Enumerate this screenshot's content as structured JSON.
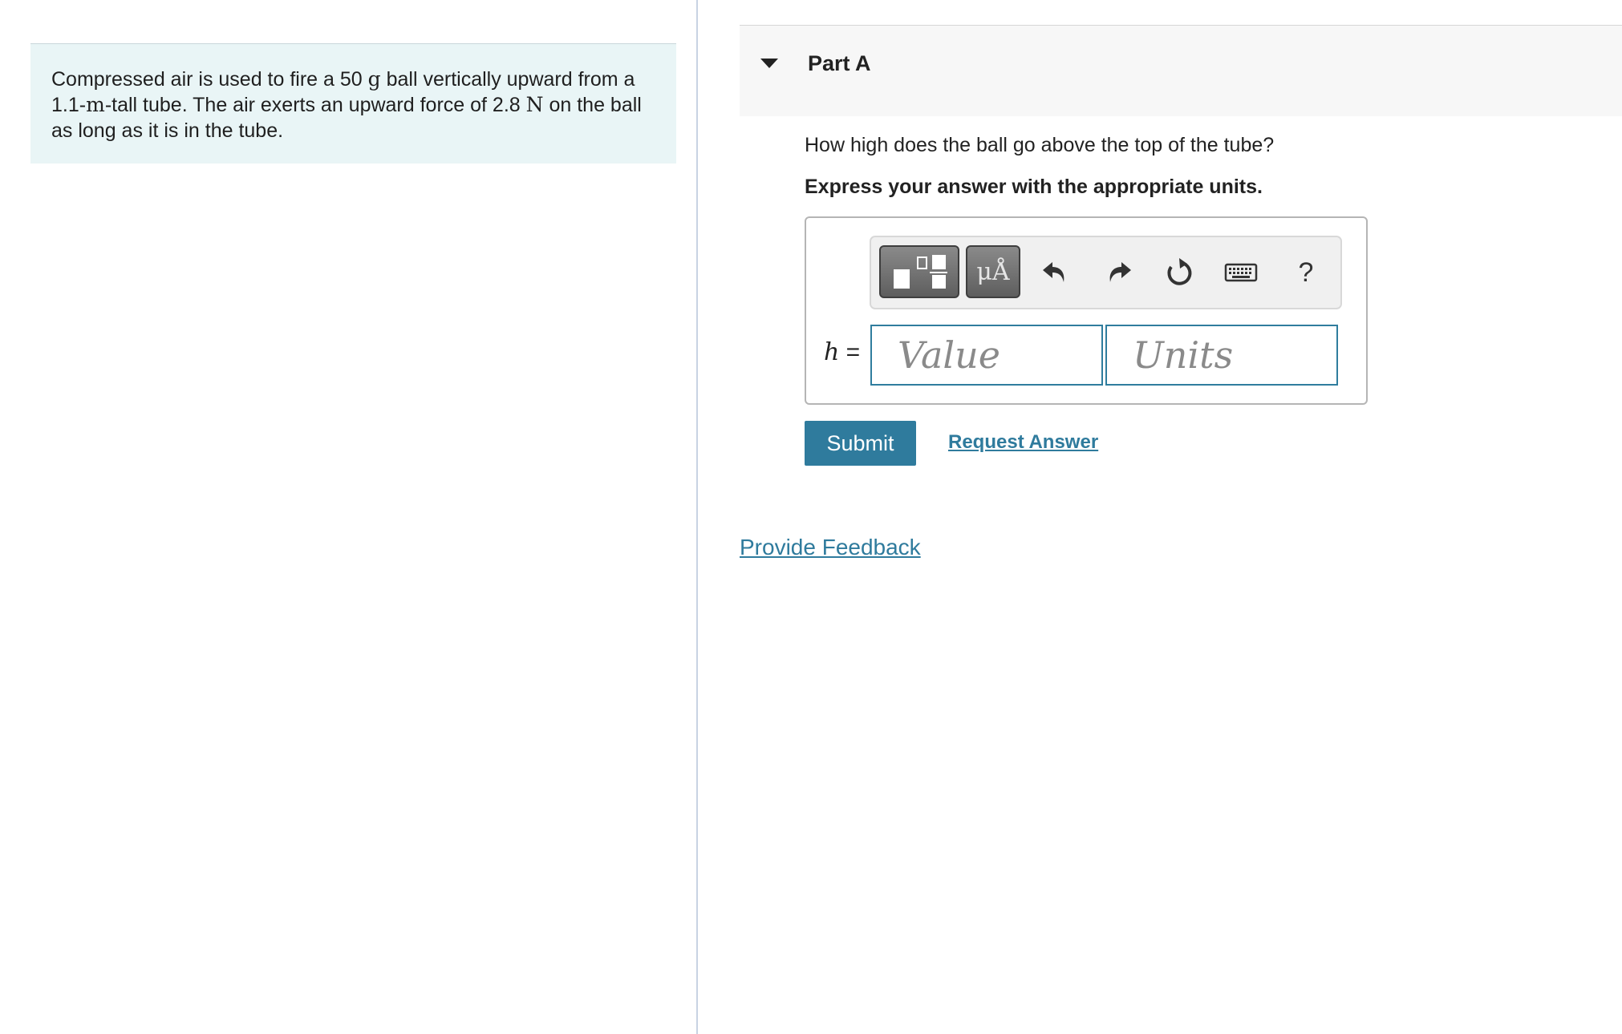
{
  "problem": {
    "segments": [
      {
        "text": "Compressed air is used to fire a 50 ",
        "math": false
      },
      {
        "text": "g",
        "math": true
      },
      {
        "text": " ball vertically upward from a 1.1-",
        "math": false
      },
      {
        "text": "m",
        "math": true
      },
      {
        "text": "-tall tube. The air exerts an upward force of 2.8 ",
        "math": false
      },
      {
        "text": "N",
        "math": true
      },
      {
        "text": " on the ball as long as it is in the tube.",
        "math": false
      }
    ]
  },
  "part": {
    "title": "Part A",
    "question": "How high does the ball go above the top of the tube?",
    "instruction": "Express your answer with the appropriate units."
  },
  "toolbar": {
    "templates_icon": "fraction-templates-icon",
    "symbols_label": "μÅ",
    "undo_icon": "undo-icon",
    "redo_icon": "redo-icon",
    "reset_icon": "reset-icon",
    "keyboard_icon": "keyboard-icon",
    "help_label": "?"
  },
  "answer": {
    "variable": "h",
    "equals": " =",
    "value_placeholder": "Value",
    "units_placeholder": "Units"
  },
  "actions": {
    "submit_label": "Submit",
    "request_label": "Request Answer"
  },
  "footer": {
    "feedback_label": "Provide Feedback"
  },
  "colors": {
    "accent": "#2f7b9d",
    "problem_bg": "#e9f5f6",
    "header_bg": "#f7f7f7"
  }
}
